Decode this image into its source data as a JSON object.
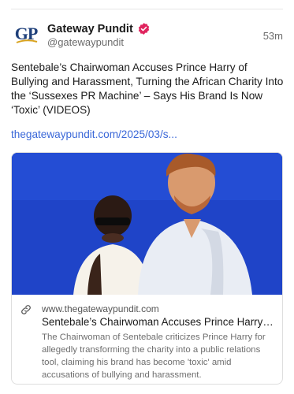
{
  "post": {
    "author_name": "Gateway Pundit",
    "handle": "@gatewaypundit",
    "timestamp": "53m",
    "avatar_text": "GP",
    "icons": {
      "verified": "verified-badge-icon",
      "link": "link-icon"
    },
    "text": "Sentebale’s Chairwoman Accuses Prince Harry of Bullying and Harassment, Turning the African Charity Into the ‘Sussexes PR Machine’ – Says His Brand Is Now ‘Toxic’ (VIDEOS)",
    "link_text": "thegatewaypundit.com/2025/03/s..."
  },
  "card": {
    "domain": "www.thegatewaypundit.com",
    "title": "Sentebale’s Chairwoman Accuses Prince Harry of Bullying and Harassment, Turning the African Charity Into the ‘Sussexes PR Machine’",
    "description": "The Chairwoman of Sentebale criticizes Prince Harry for allegedly transforming the charity into a public relations tool, claiming his brand has become 'toxic' amid accusations of bullying and harassment."
  },
  "colors": {
    "accent_link": "#3b68d8",
    "verified_badge": "#e0245e",
    "image_background": "#1f44c8"
  }
}
